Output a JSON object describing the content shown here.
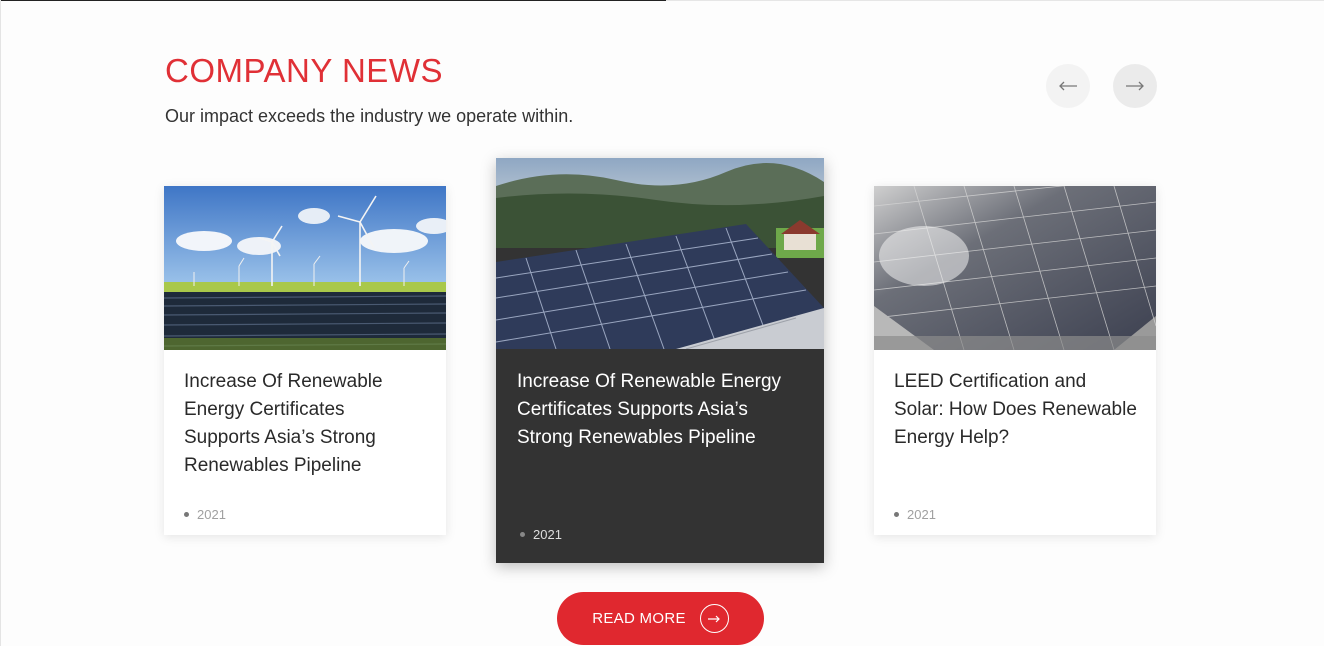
{
  "section": {
    "title": "COMPANY NEWS",
    "subtitle": "Our impact exceeds the industry we operate within."
  },
  "carousel": {
    "prev_icon": "arrow-left-icon",
    "next_icon": "arrow-right-icon"
  },
  "cards": [
    {
      "title": "Increase Of Renewable Energy Certificates Supports Asia’s Strong Renewables Pipeline",
      "year": "2021",
      "image": "wind-turbines-solar-field"
    },
    {
      "title": "Increase Of Renewable Energy Certificates Supports Asia’s Strong Renewables Pipeline",
      "year": "2021",
      "image": "rooftop-solar-mountains"
    },
    {
      "title": "LEED Certification and Solar: How Does Renewable Energy Help?",
      "year": "2021",
      "image": "rooftop-solar-panels"
    }
  ],
  "cta": {
    "label": "READ MORE",
    "icon": "arrow-right-icon"
  },
  "colors": {
    "accent": "#e03036",
    "active_card": "#333333"
  }
}
